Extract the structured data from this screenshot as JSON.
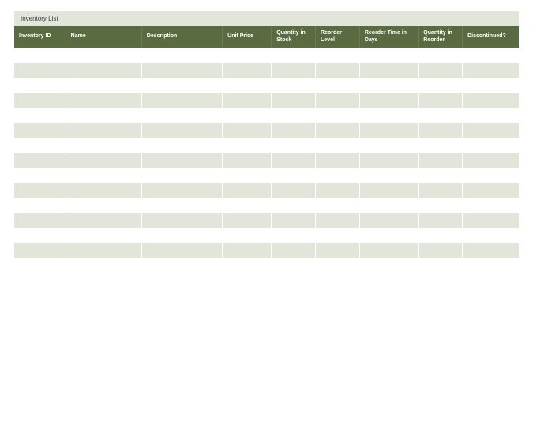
{
  "title": "Inventory List",
  "columns": [
    "Inventory ID",
    "Name",
    "Description",
    "Unit Price",
    "Quantity in Stock",
    "Reorder Level",
    "Reorder Time in Days",
    "Quantity in Reorder",
    "Discontinued?"
  ],
  "rows": [
    [
      "",
      "",
      "",
      "",
      "",
      "",
      "",
      "",
      ""
    ],
    [
      "",
      "",
      "",
      "",
      "",
      "",
      "",
      "",
      ""
    ],
    [
      "",
      "",
      "",
      "",
      "",
      "",
      "",
      "",
      ""
    ],
    [
      "",
      "",
      "",
      "",
      "",
      "",
      "",
      "",
      ""
    ],
    [
      "",
      "",
      "",
      "",
      "",
      "",
      "",
      "",
      ""
    ],
    [
      "",
      "",
      "",
      "",
      "",
      "",
      "",
      "",
      ""
    ],
    [
      "",
      "",
      "",
      "",
      "",
      "",
      "",
      "",
      ""
    ],
    [
      "",
      "",
      "",
      "",
      "",
      "",
      "",
      "",
      ""
    ],
    [
      "",
      "",
      "",
      "",
      "",
      "",
      "",
      "",
      ""
    ],
    [
      "",
      "",
      "",
      "",
      "",
      "",
      "",
      "",
      ""
    ],
    [
      "",
      "",
      "",
      "",
      "",
      "",
      "",
      "",
      ""
    ],
    [
      "",
      "",
      "",
      "",
      "",
      "",
      "",
      "",
      ""
    ],
    [
      "",
      "",
      "",
      "",
      "",
      "",
      "",
      "",
      ""
    ],
    [
      "",
      "",
      "",
      "",
      "",
      "",
      "",
      "",
      ""
    ]
  ]
}
